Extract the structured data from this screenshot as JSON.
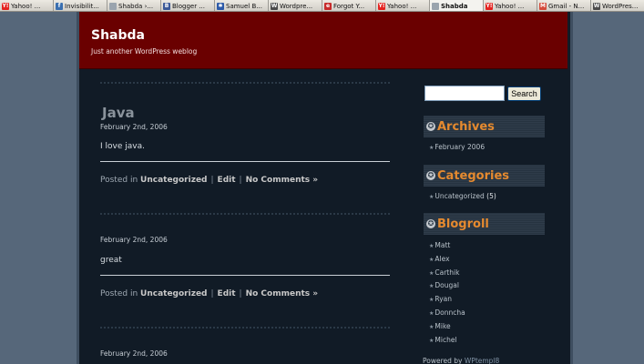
{
  "browser": {
    "tabs": [
      {
        "label": "Yahoo! ...",
        "icon": "yahoo-icon",
        "color": "#e4231f",
        "glyph": "Y!"
      },
      {
        "label": "Invisibilit...",
        "icon": "feed-icon",
        "color": "#3a6fb0",
        "glyph": "f"
      },
      {
        "label": "Shabda ›...",
        "icon": "page-icon",
        "color": "#9aa4ae",
        "glyph": ""
      },
      {
        "label": "Blogger ...",
        "icon": "blogger-icon",
        "color": "#3b5998",
        "glyph": "B"
      },
      {
        "label": "Samuel B...",
        "icon": "star-icon",
        "color": "#2d5aa8",
        "glyph": "✱"
      },
      {
        "label": "Wordpre...",
        "icon": "wordpress-icon",
        "color": "#4b4b4b",
        "glyph": "W"
      },
      {
        "label": "Forgot Y...",
        "icon": "ebay-icon",
        "color": "#c72b2b",
        "glyph": "e"
      },
      {
        "label": "Yahoo! ...",
        "icon": "yahoo-icon",
        "color": "#e4231f",
        "glyph": "Y!"
      },
      {
        "label": "Shabda",
        "icon": "page-icon",
        "color": "#9aa4ae",
        "glyph": "",
        "active": true
      },
      {
        "label": "Yahoo! ...",
        "icon": "yahoo-icon",
        "color": "#e4231f",
        "glyph": "Y!"
      },
      {
        "label": "Gmail - N...",
        "icon": "gmail-icon",
        "color": "#d44a3a",
        "glyph": "M"
      },
      {
        "label": "WordPres...",
        "icon": "wordpress-icon",
        "color": "#4b4b4b",
        "glyph": "W"
      }
    ]
  },
  "site": {
    "title": "Shabda",
    "description": "Just another WordPress weblog"
  },
  "posts": [
    {
      "title": "Java",
      "date": "February 2nd, 2006",
      "body": "I love java.",
      "posted_in": "Posted in",
      "category": "Uncategorized",
      "edit": "Edit",
      "comments": "No Comments »"
    },
    {
      "title": "",
      "date": "February 2nd, 2006",
      "body": "great",
      "posted_in": "Posted in",
      "category": "Uncategorized",
      "edit": "Edit",
      "comments": "No Comments »"
    },
    {
      "title": "",
      "date": "February 2nd, 2006"
    }
  ],
  "sidebar": {
    "search": {
      "value": "",
      "button": "Search"
    },
    "archives": {
      "title": "Archives",
      "items": [
        "February 2006"
      ]
    },
    "categories": {
      "title": "Categories",
      "items": [
        {
          "name": "Uncategorized",
          "count": "(5)"
        }
      ]
    },
    "blogroll": {
      "title": "Blogroll",
      "items": [
        "Matt",
        "Alex",
        "Carthik",
        "Dougal",
        "Ryan",
        "Donncha",
        "Mike",
        "Michel"
      ]
    },
    "powered_by": "Powered by",
    "powered_link": "WPtempl8"
  },
  "colors": {
    "header_bg": "#6a0000",
    "page_bg": "#111b26",
    "widget_title": "#e58a2f"
  }
}
